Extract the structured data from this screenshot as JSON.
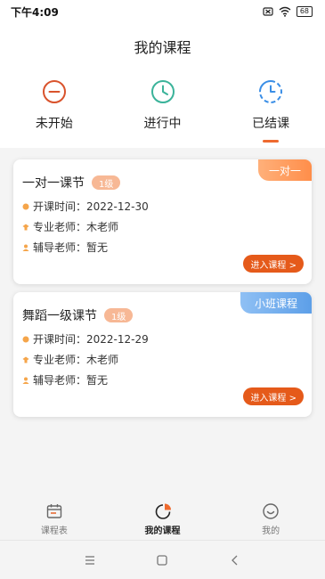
{
  "status_bar": {
    "time": "下午4:09",
    "battery": "68"
  },
  "header": {
    "title": "我的课程"
  },
  "tabs": [
    {
      "label": "未开始",
      "icon": "not-started-icon",
      "color": "#d9532c"
    },
    {
      "label": "进行中",
      "icon": "in-progress-icon",
      "color": "#3bb39a"
    },
    {
      "label": "已结课",
      "icon": "finished-icon",
      "color": "#3a8ee6",
      "active": true
    }
  ],
  "courses": [
    {
      "title": "一对一课节",
      "level": "1级",
      "tag": "一对一",
      "tag_color": "#ff8e4a",
      "start_label": "开课时间：",
      "start_date": "2022-12-30",
      "teacher_label": "专业老师：",
      "teacher": "木老师",
      "tutor_label": "辅导老师：",
      "tutor": "暂无",
      "button": "进入课程 >"
    },
    {
      "title": "舞蹈一级课节",
      "level": "1级",
      "tag": "小班课程",
      "tag_color": "#5d9fe8",
      "start_label": "开课时间：",
      "start_date": "2022-12-29",
      "teacher_label": "专业老师：",
      "teacher": "木老师",
      "tutor_label": "辅导老师：",
      "tutor": "暂无",
      "button": "进入课程 >"
    }
  ],
  "tabbar": [
    {
      "label": "课程表",
      "icon": "calendar-icon"
    },
    {
      "label": "我的课程",
      "icon": "pie-chart-icon",
      "active": true
    },
    {
      "label": "我的",
      "icon": "smile-icon"
    }
  ],
  "accent_color": "#e55a1a"
}
